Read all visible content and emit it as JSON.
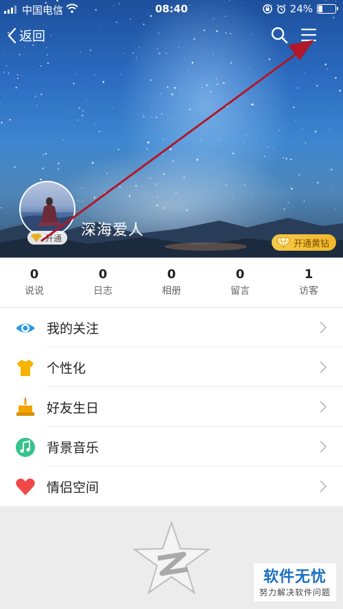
{
  "status_bar": {
    "carrier": "中国电信",
    "time": "08:40",
    "battery": "24%"
  },
  "nav": {
    "back_label": "返回"
  },
  "profile": {
    "nickname": "深海爱人",
    "open_badge": "开通",
    "yellow_diamond": "开通黄钻"
  },
  "stats": [
    {
      "value": "0",
      "label": "说说"
    },
    {
      "value": "0",
      "label": "日志"
    },
    {
      "value": "0",
      "label": "相册"
    },
    {
      "value": "0",
      "label": "留言"
    },
    {
      "value": "1",
      "label": "访客"
    }
  ],
  "menu": [
    {
      "label": "我的关注",
      "icon": "eye-icon",
      "color": "#2a9be3"
    },
    {
      "label": "个性化",
      "icon": "tshirt-icon",
      "color": "#f5b400"
    },
    {
      "label": "好友生日",
      "icon": "cake-icon",
      "color": "#f2a400"
    },
    {
      "label": "背景音乐",
      "icon": "music-note-icon",
      "color": "#34c48a"
    },
    {
      "label": "情侣空间",
      "icon": "heart-icon",
      "color": "#f04848"
    }
  ],
  "watermark": {
    "title": "软件无忧",
    "subtitle": "努力解决软件问题"
  },
  "colors": {
    "arrow": "#b0172a",
    "accent_blue": "#1a6fc2",
    "gold": "#f3c13a"
  }
}
